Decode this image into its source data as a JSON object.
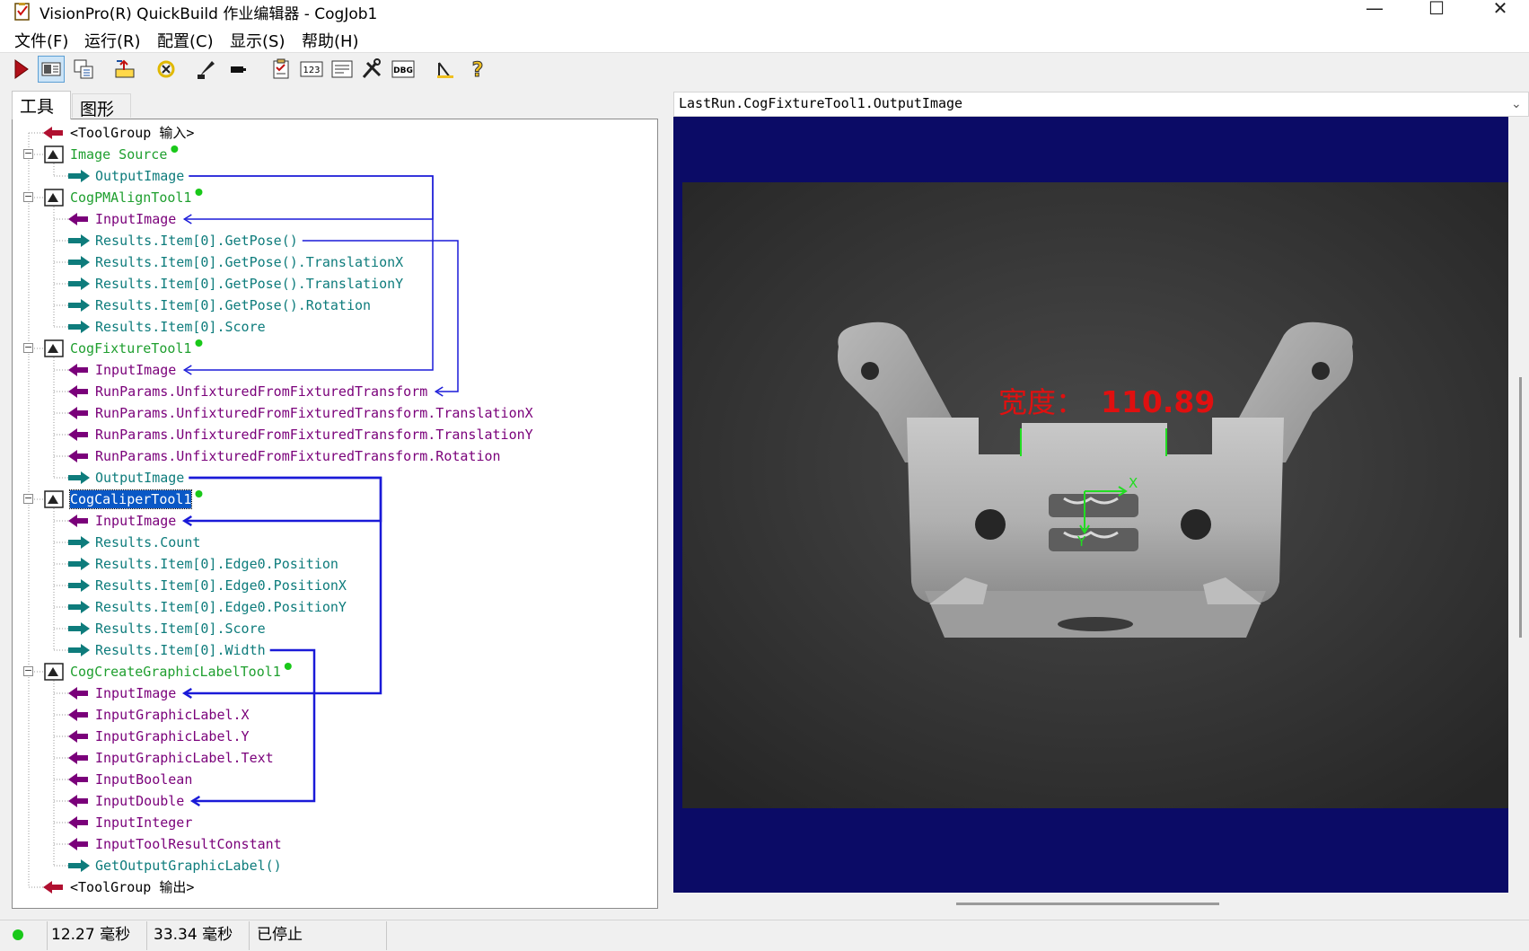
{
  "window": {
    "title": "VisionPro(R) QuickBuild 作业编辑器 - CogJob1",
    "minimize": "—",
    "maximize": "☐",
    "close": "✕"
  },
  "menu": {
    "items": [
      "文件(F)",
      "运行(R)",
      "配置(C)",
      "显示(S)",
      "帮助(H)"
    ]
  },
  "toolbar": {
    "icons": [
      "run-once-icon",
      "display-toggle-icon",
      "copy-icon",
      "reset-icon",
      "refresh-icon",
      "edit-icon",
      "record-icon",
      "clipboard-icon",
      "counter-icon",
      "results-icon",
      "tools-icon",
      "debug-icon",
      "properties-icon",
      "help-icon"
    ],
    "counter_label": "123",
    "debug_label": "DBG"
  },
  "tabs": {
    "tools": "工具",
    "graphics": "图形"
  },
  "tree": {
    "nodes": [
      {
        "label": "<ToolGroup 输入>",
        "color": "black",
        "kind": "group-in"
      },
      {
        "label": "Image Source",
        "color": "green",
        "kind": "tool",
        "dot": true
      },
      {
        "label": "OutputImage",
        "color": "teal",
        "kind": "output"
      },
      {
        "label": "CogPMAlignTool1",
        "color": "green",
        "kind": "tool",
        "dot": true
      },
      {
        "label": "InputImage",
        "color": "purple",
        "kind": "input"
      },
      {
        "label": "Results.Item[0].GetPose()",
        "color": "teal",
        "kind": "output"
      },
      {
        "label": "Results.Item[0].GetPose().TranslationX",
        "color": "teal",
        "kind": "output"
      },
      {
        "label": "Results.Item[0].GetPose().TranslationY",
        "color": "teal",
        "kind": "output"
      },
      {
        "label": "Results.Item[0].GetPose().Rotation",
        "color": "teal",
        "kind": "output"
      },
      {
        "label": "Results.Item[0].Score",
        "color": "teal",
        "kind": "output"
      },
      {
        "label": "CogFixtureTool1",
        "color": "green",
        "kind": "tool",
        "dot": true
      },
      {
        "label": "InputImage",
        "color": "purple",
        "kind": "input"
      },
      {
        "label": "RunParams.UnfixturedFromFixturedTransform",
        "color": "purple",
        "kind": "input"
      },
      {
        "label": "RunParams.UnfixturedFromFixturedTransform.TranslationX",
        "color": "purple",
        "kind": "input"
      },
      {
        "label": "RunParams.UnfixturedFromFixturedTransform.TranslationY",
        "color": "purple",
        "kind": "input"
      },
      {
        "label": "RunParams.UnfixturedFromFixturedTransform.Rotation",
        "color": "purple",
        "kind": "input"
      },
      {
        "label": "OutputImage",
        "color": "teal",
        "kind": "output"
      },
      {
        "label": "CogCaliperTool1",
        "color": "green",
        "kind": "tool",
        "dot": true,
        "selected": true
      },
      {
        "label": "InputImage",
        "color": "purple",
        "kind": "input"
      },
      {
        "label": "Results.Count",
        "color": "teal",
        "kind": "output"
      },
      {
        "label": "Results.Item[0].Edge0.Position",
        "color": "teal",
        "kind": "output"
      },
      {
        "label": "Results.Item[0].Edge0.PositionX",
        "color": "teal",
        "kind": "output"
      },
      {
        "label": "Results.Item[0].Edge0.PositionY",
        "color": "teal",
        "kind": "output"
      },
      {
        "label": "Results.Item[0].Score",
        "color": "teal",
        "kind": "output"
      },
      {
        "label": "Results.Item[0].Width",
        "color": "teal",
        "kind": "output"
      },
      {
        "label": "CogCreateGraphicLabelTool1",
        "color": "green",
        "kind": "tool",
        "dot": true
      },
      {
        "label": "InputImage",
        "color": "purple",
        "kind": "input"
      },
      {
        "label": "InputGraphicLabel.X",
        "color": "purple",
        "kind": "input"
      },
      {
        "label": "InputGraphicLabel.Y",
        "color": "purple",
        "kind": "input"
      },
      {
        "label": "InputGraphicLabel.Text",
        "color": "purple",
        "kind": "input"
      },
      {
        "label": "InputBoolean",
        "color": "purple",
        "kind": "input"
      },
      {
        "label": "InputDouble",
        "color": "purple",
        "kind": "input"
      },
      {
        "label": "InputInteger",
        "color": "purple",
        "kind": "input"
      },
      {
        "label": "InputToolResultConstant",
        "color": "purple",
        "kind": "input"
      },
      {
        "label": "GetOutputGraphicLabel()",
        "color": "teal",
        "kind": "output"
      },
      {
        "label": "<ToolGroup 输出>",
        "color": "black",
        "kind": "group-out"
      }
    ]
  },
  "image_view": {
    "selector": "LastRun.CogFixtureTool1.OutputImage",
    "overlay_label": "宽度：",
    "overlay_value": "110.89",
    "axis_x": "X",
    "axis_y": "Y",
    "overlay_color": "#e01010",
    "axis_color": "#22dd22",
    "background_color": "#0b0b66"
  },
  "status": {
    "indicator_color": "#19c819",
    "time1": "12.27 毫秒",
    "time2": "33.34 毫秒",
    "state": "已停止"
  }
}
